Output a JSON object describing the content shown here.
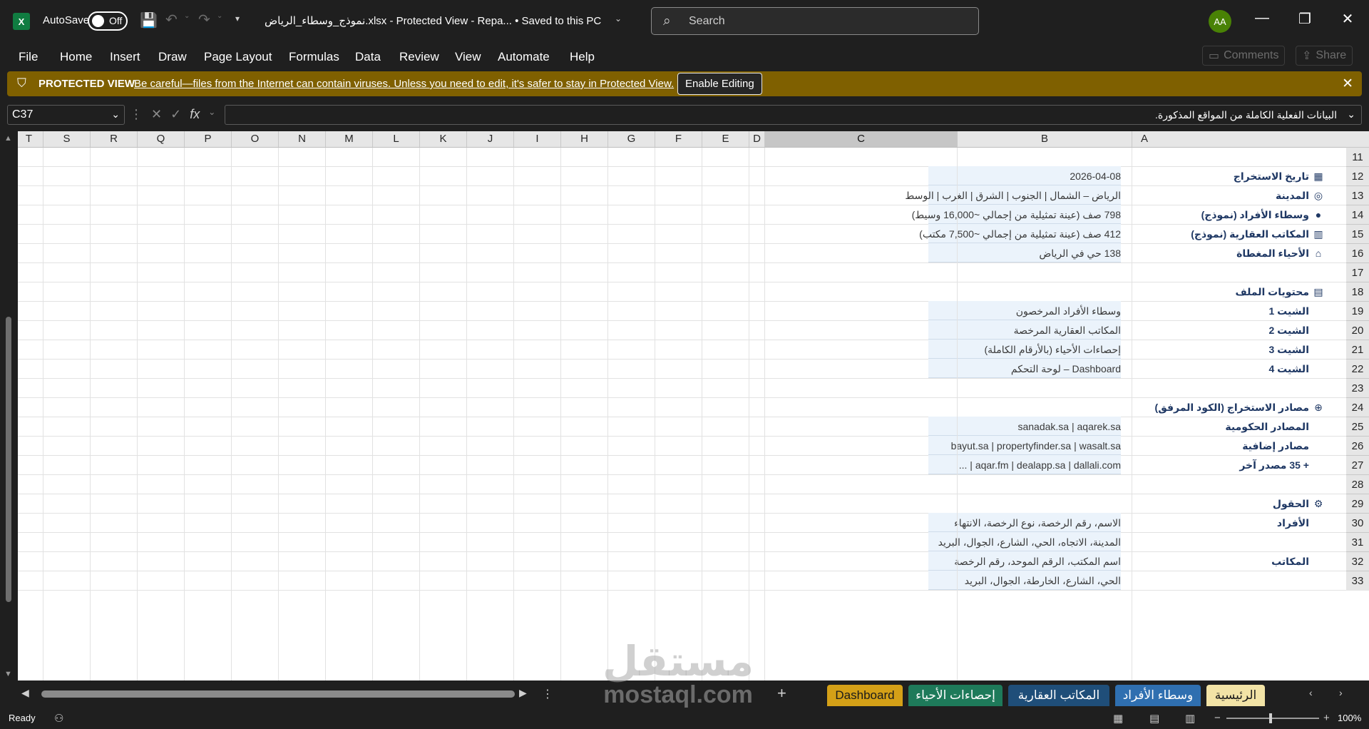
{
  "titlebar": {
    "autosave_label": "AutoSave",
    "autosave_state": "Off",
    "filename": "نموذج_وسطاء_الرياض.xlsx  -  Protected View  -  Repa...  •  Saved to this PC",
    "search_placeholder": "Search",
    "avatar_initials": "AA"
  },
  "ribbon": {
    "menus": [
      "File",
      "Home",
      "Insert",
      "Draw",
      "Page Layout",
      "Formulas",
      "Data",
      "Review",
      "View",
      "Automate",
      "Help"
    ],
    "comments_label": "Comments",
    "share_label": "Share"
  },
  "protected_view": {
    "title": "PROTECTED VIEW",
    "message": "Be careful—files from the Internet can contain viruses. Unless you need to edit, it's safer to stay in Protected View.",
    "button": "Enable Editing"
  },
  "formula_bar": {
    "cell_ref": "C37",
    "content": "البيانات الفعلية الكاملة من المواقع المذكورة."
  },
  "columns": [
    "T",
    "S",
    "R",
    "Q",
    "P",
    "O",
    "N",
    "M",
    "L",
    "K",
    "J",
    "I",
    "H",
    "G",
    "F",
    "E",
    "D",
    "C",
    "B",
    "A"
  ],
  "selected_column": "C",
  "rows": [
    11,
    12,
    13,
    14,
    15,
    16,
    17,
    18,
    19,
    20,
    21,
    22,
    23,
    24,
    25,
    26,
    27,
    28,
    29,
    30,
    31,
    32,
    33
  ],
  "sheet": {
    "r12": {
      "icon": "calendar-icon",
      "label": "تاريخ الاستخراج",
      "value": "2026-04-08"
    },
    "r13": {
      "icon": "target-icon",
      "label": "المدينة",
      "value": "الرياض – الشمال | الجنوب | الشرق | الغرب | الوسط"
    },
    "r14": {
      "icon": "person-icon",
      "label": "وسطاء الأفراد (نموذج)",
      "value": "798 صف (عينة تمثيلية من إجمالي ~16,000 وسيط)"
    },
    "r15": {
      "icon": "building-icon",
      "label": "المكاتب العقارية (نموذج)",
      "value": "412 صف (عينة تمثيلية من إجمالي ~7,500 مكتب)"
    },
    "r16": {
      "icon": "houses-icon",
      "label": "الأحياء المغطاة",
      "value": "138 حي في الرياض"
    },
    "r18": {
      "icon": "clipboard-icon",
      "label": "محتويات الملف"
    },
    "r19": {
      "label": "الشيت 1",
      "value": "وسطاء الأفراد المرخصون"
    },
    "r20": {
      "label": "الشيت 2",
      "value": "المكاتب العقارية المرخصة"
    },
    "r21": {
      "label": "الشيت 3",
      "value": "إحصاءات الأحياء (بالأرقام الكاملة)"
    },
    "r22": {
      "label": "الشيت 4",
      "value": "Dashboard – لوحة التحكم"
    },
    "r24": {
      "icon": "globe-icon",
      "label": "مصادر الاستخراج (الكود المرفق)"
    },
    "r25": {
      "label": "المصادر الحكومية",
      "value": "sanadak.sa | aqarek.sa"
    },
    "r26": {
      "label": "مصادر إضافية",
      "value": "bayut.sa | propertyfinder.sa | wasalt.sa"
    },
    "r27": {
      "label": "+ 35 مصدر آخر",
      "value": "aqar.fm | dealapp.sa | dallali.com | ..."
    },
    "r29": {
      "icon": "gear-icon",
      "label": "الحقول"
    },
    "r30": {
      "label": "الأفراد",
      "value": "الاسم، رقم الرخصة، نوع الرخصة، الانتهاء"
    },
    "r31": {
      "value": "المدينة، الاتجاه، الحي، الشارع، الجوال، البريد"
    },
    "r32": {
      "label": "المكاتب",
      "value": "اسم المكتب، الرقم الموحد، رقم الرخصة"
    },
    "r33": {
      "value": "الحي، الشارع، الخارطة، الجوال، البريد"
    }
  },
  "tabs": [
    {
      "label": "الرئيسية",
      "bg": "#f2e3a6",
      "fg": "#1a1a1a"
    },
    {
      "label": "وسطاء الأفراد",
      "bg": "#2f6fb0",
      "fg": "#ffffff"
    },
    {
      "label": "المكاتب العقارية",
      "bg": "#1f4e79",
      "fg": "#ffffff"
    },
    {
      "label": "إحصاءات الأحياء",
      "bg": "#1e7a5a",
      "fg": "#ffffff"
    },
    {
      "label": "Dashboard",
      "bg": "#d4a017",
      "fg": "#1a1a1a"
    }
  ],
  "watermark": {
    "arabic": "مستقل",
    "latin": "mostaql.com"
  },
  "status": {
    "ready": "Ready",
    "zoom": "100%"
  },
  "colors": {
    "accent": "#107c41",
    "header_text": "#1f3864",
    "cell_fill": "#ebf3fb",
    "protected_bar": "#7f6000"
  }
}
